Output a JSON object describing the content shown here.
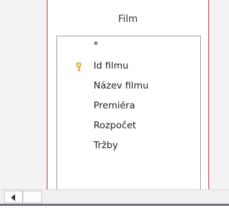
{
  "table": {
    "title": "Film",
    "fields": [
      {
        "label": "*",
        "primary_key": false
      },
      {
        "label": "Id filmu",
        "primary_key": true
      },
      {
        "label": "Název filmu",
        "primary_key": false
      },
      {
        "label": "Premiéra",
        "primary_key": false
      },
      {
        "label": "Rozpočet",
        "primary_key": false
      },
      {
        "label": "Tržby",
        "primary_key": false
      }
    ]
  },
  "icons": {
    "primary_key": "key-icon",
    "scroll_left": "left-arrow-icon"
  },
  "colors": {
    "table_border": "#b23a3a",
    "key_icon": "#c9a227",
    "status_line": "#6a6f80"
  }
}
